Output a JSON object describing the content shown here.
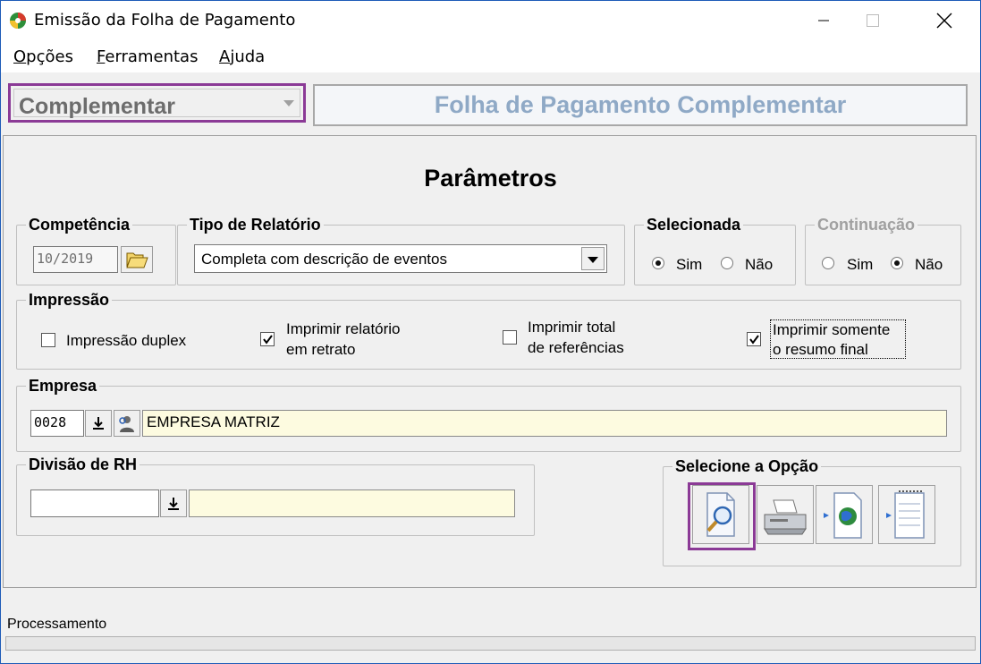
{
  "window": {
    "title": "Emissão da Folha de Pagamento"
  },
  "menu": {
    "items": [
      {
        "label": "Opções",
        "ul": "O",
        "rest": "pções"
      },
      {
        "label": "Ferramentas",
        "ul": "F",
        "rest": "erramentas"
      },
      {
        "label": "Ajuda",
        "ul": "A",
        "rest": "juda"
      }
    ]
  },
  "type_select": {
    "value": "Complementar"
  },
  "banner": {
    "text": "Folha de Pagamento Complementar"
  },
  "params": {
    "title": "Parâmetros"
  },
  "competencia": {
    "legend": "Competência",
    "value": "10/2019"
  },
  "tipo_relatorio": {
    "legend": "Tipo de Relatório",
    "value": "Completa com descrição de eventos"
  },
  "selecionada": {
    "legend": "Selecionada",
    "sim": "Sim",
    "nao": "Não",
    "selected": "Sim"
  },
  "continuacao": {
    "legend": "Continuação",
    "sim": "Sim",
    "nao": "Não",
    "selected": "Não"
  },
  "impressao": {
    "legend": "Impressão",
    "duplex": {
      "label": "Impressão duplex",
      "checked": false
    },
    "retrato": {
      "line1": "Imprimir relatório",
      "line2": "em retrato",
      "checked": true
    },
    "total_ref": {
      "line1": "Imprimir total",
      "line2": "de referências",
      "checked": false
    },
    "resumo": {
      "line1": "Imprimir somente",
      "line2": "o resumo final",
      "checked": true
    }
  },
  "empresa": {
    "legend": "Empresa",
    "code": "0028",
    "name": "EMPRESA MATRIZ"
  },
  "divisao": {
    "legend": "Divisão de RH",
    "code": "",
    "name": ""
  },
  "opcao": {
    "legend": "Selecione a Opção"
  },
  "status": {
    "label": "Processamento"
  },
  "colors": {
    "highlight": "#8b3a96",
    "banner_text": "#8fa9c6",
    "lookup_bg": "#fdfbe0"
  }
}
